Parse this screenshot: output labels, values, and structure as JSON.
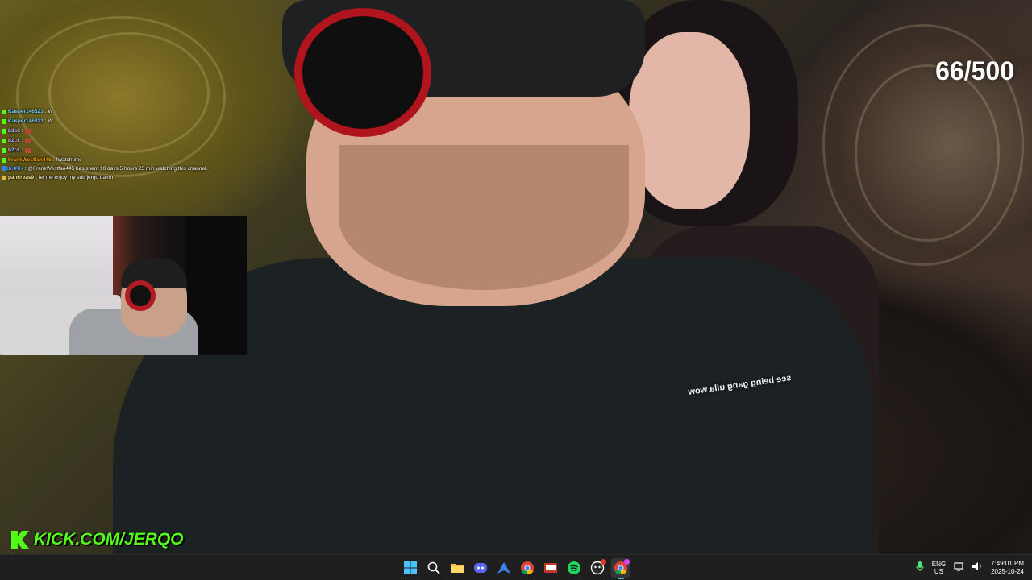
{
  "stream": {
    "score": "66/500",
    "caption": "see being gang ulla wow",
    "kick_url": "KICK.COM/JERQO"
  },
  "chat": {
    "messages": [
      {
        "user": "Kasper146823",
        "sep": " : ",
        "text": "W",
        "user_color": "#7dd3fc",
        "badge": "green"
      },
      {
        "user": "Kasper146823",
        "sep": " : ",
        "text": "W",
        "user_color": "#7dd3fc",
        "badge": "green"
      },
      {
        "user": "b2ck",
        "sep": " : ",
        "text": "",
        "emote": true,
        "user_color": "#c4b5fd",
        "badge": "green"
      },
      {
        "user": "b2ck",
        "sep": " : ",
        "text": "",
        "emote": true,
        "user_color": "#c4b5fd",
        "badge": "green"
      },
      {
        "user": "b2ck",
        "sep": " : ",
        "text": "",
        "emote": true,
        "user_color": "#c4b5fd",
        "badge": "green"
      },
      {
        "user": "FrankWestfan445",
        "sep": " : ",
        "text": "!Watchtime",
        "user_color": "#f59e0b",
        "badge": "green"
      },
      {
        "user": "BotRix",
        "sep": " : ",
        "text": "@FrankWestfan445 has spent 10 days 5 hours 25 min watching this channel.",
        "user_color": "#60a5fa",
        "badge": "blue"
      },
      {
        "user": "pancreas9",
        "sep": " : ",
        "text": "let me enjoy my sub jerqo damn",
        "user_color": "#fde68a",
        "badge": "gold"
      }
    ]
  },
  "taskbar": {
    "apps": [
      {
        "name": "start-button",
        "icon": "windows-logo"
      },
      {
        "name": "search-button",
        "icon": "search-icon"
      },
      {
        "name": "file-explorer-button",
        "icon": "folder-icon"
      },
      {
        "name": "discord-button",
        "icon": "discord-icon"
      },
      {
        "name": "app-button",
        "icon": "arrow-app-icon"
      },
      {
        "name": "chrome-button",
        "icon": "chrome-icon"
      },
      {
        "name": "obs-button",
        "icon": "recorder-icon"
      },
      {
        "name": "spotify-button",
        "icon": "spotify-icon"
      },
      {
        "name": "game-app-button",
        "icon": "game-app-icon"
      },
      {
        "name": "chrome-active-button",
        "icon": "chrome-icon"
      }
    ],
    "lang_line1": "ENG",
    "lang_line2": "US",
    "time": "7:49:01 PM",
    "date": "2025-10-24"
  },
  "colors": {
    "kick_green": "#53fc18",
    "taskbar_bg": "#1f1f1f",
    "score_text": "#ffffff"
  }
}
